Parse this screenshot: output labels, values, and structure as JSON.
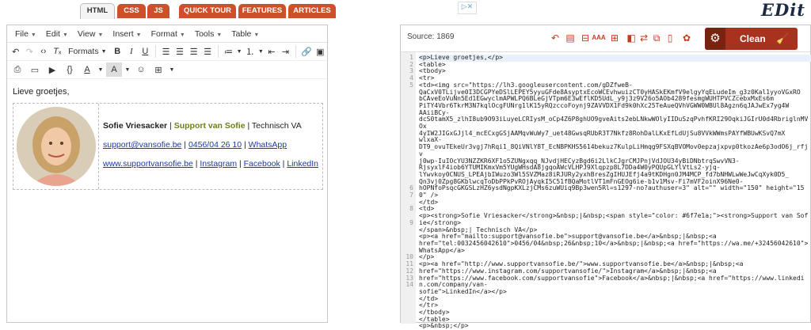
{
  "tabs": [
    {
      "label": "HTML",
      "active": true
    },
    {
      "label": "CSS",
      "active": false
    },
    {
      "label": "JS",
      "active": false
    },
    {
      "label": "QUICK TOUR",
      "active": false
    },
    {
      "label": "FEATURES",
      "active": false
    },
    {
      "label": "ARTICLES",
      "active": false
    }
  ],
  "logo": "EDit",
  "editor": {
    "menus": [
      "File",
      "Edit",
      "View",
      "Insert",
      "Format",
      "Tools",
      "Table"
    ],
    "formats_label": "Formats",
    "greeting": "Lieve groetjes,",
    "signature": {
      "name": "Sofie Vriesacker",
      "sep1": " | ",
      "company": "Support van Sofie",
      "sep2": " | Technisch VA",
      "email": "support@vansofie.be",
      "phone": "0456/04 26 10",
      "whatsapp": "WhatsApp",
      "website": "www.supportvansofie.be",
      "instagram": "Instagram",
      "facebook": "Facebook",
      "linkedin": "LinkedIn",
      "pipe": " | "
    }
  },
  "source": {
    "label": "Source: 1869",
    "clean_label": "Clean",
    "line_numbers": [
      "1",
      "2",
      "3",
      "4",
      "5",
      "",
      "",
      "",
      "",
      "",
      "",
      "",
      "",
      "",
      "",
      "",
      "",
      "",
      "",
      "6",
      "7",
      "",
      "8",
      "",
      "9",
      "",
      "",
      "",
      "",
      "10",
      "11",
      "12",
      "13",
      "14"
    ],
    "lines": [
      "<p>Lieve groetjes,</p>",
      "<table>",
      "<tbody>",
      "<tr>",
      "<td><img src=\"https://lh3.googleusercontent.com/gDZfweB-",
      "QaCxV0TLijve0I3DCGPYeDSlLEPEY5yyuGFde8AsyptxEcoWCEvhwuizCT0yHASkEKmfV9elgyYqELudeIm_g3z0Kal1yyoVGxRO",
      "bCAveEoVuNn5Ed1EGwyclmAPWLPQ6BLeGjVTpm6E3wEflKD5UdL_y9j3z9V26o5AOb4289fesmgWUHTPVCZcebxMxEs6m",
      "PiTY4Vbr6TkrM3N7kqlOcgFUNrg1lK15yRQzccoFoynj9ZAVVDX1Fd9k0hXc25TeAueQVhVGWW0WBUl8Agzn6qJAJwEx7yg4W",
      "AAiiBCy-",
      "dcS0tamX5_zlhI8ub9O93iLuyeLCRIysM_oCp4Z6P8ghUO9gveAits2ebLNkwWOlyIIDuSzqPvhfKRI29OqkiJGIrU0d4RbriglnMVOx",
      "4yIW2JIGxGJjl4_mcECxgGSjAAMqvWuWy7_uet48GwsqRUbR3T7Nkfz8RohDalLKxEfLdUjSu8VVkWWmsPAYfWBUwKSvQ7mX",
      "wlxaX-",
      "DT9_ovuTEkeUr3vgj7hRqi1_8QiVNlY8T_EcNBPKHS5614bekuz7KulpLiHmqg9FSXqBVOMov0epzajxpvp0tkozAe6p3odO6j_rfjv",
      "j0wp-IuIOcYU3NZZKR6XF1o5ZUNgxqq_NJvdjHECyzBgd6i2LlkCJgrCMJPnjVdJOU34yBiDNbtrqSwvVN3-",
      "RjsyxlF4iob6YTUMIKmxVm5YUgWHsdA8jgqoAWcVLHPJ9Xlqpzp8L7DDa4W0yPQUpGLYlVtLs2-yjq-",
      "lYwvkoy0CNUS_LPEAjbIWuzo3Wl5SVZMaz8iRJURy2yxhBresZgIHUJEfj4a9tKDHgn0JM4MCP_fd7bNHWLwWeJwCqXyk0D5_",
      "Qn3vj0Zpg8GKblwcqToDbPPkPvROjAyqkI5C51fBQaMotlVT1mFnGEOg6ie-b1v1Msv-Fi7mVF2oinX96Ne0-",
      "hOPNfoPsqcGKGSLzHZ6ysdNgpKXLzjCMs6zuWUiq9Bp3wen5Rl=s1297-no?authuser=3\" alt=\"\" width=\"150\" height=\"150\" />",
      "</td>",
      "<td>",
      "<p><strong>Sofie Vriesacker</strong>&nbsp;|&nbsp;<span style=\"color: #6f7e1a;\"><strong>Support van Sofie</strong>",
      "</span>&nbsp;| Technisch VA</p>",
      "<p><a href=\"mailto:support@vansofie.be\">support@vansofie.be</a>&nbsp;|&nbsp;<a",
      "href=\"tel:0032456042610\">0456/04&nbsp;26&nbsp;10</a>&nbsp;|&nbsp;<a href=\"https://wa.me/+32456042610\">WhatsApp</a>",
      "</p>",
      "<p><a href=\"http://www.supportvansofie.be/\">www.supportvansofie.be</a>&nbsp;|&nbsp;<a",
      "href=\"https://www.instagram.com/supportvansofie/\">Instagram</a>&nbsp;|&nbsp;<a",
      "href=\"https://www.facebook.com/supportvansofie\">Facebook</a>&nbsp;|&nbsp;<a href=\"https://www.linkedin.com/company/van-",
      "sofie\">LinkedIn</a></p>",
      "</td>",
      "</tr>",
      "</tbody>",
      "</table>",
      "<p>&nbsp;</p>"
    ]
  }
}
